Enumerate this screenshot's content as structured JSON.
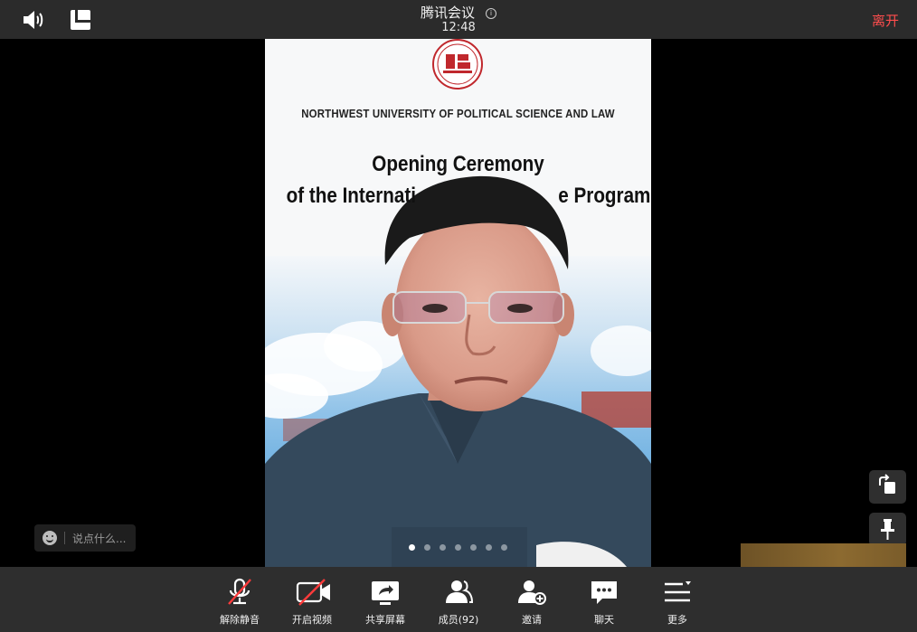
{
  "header": {
    "title": "腾讯会议",
    "time": "12:48",
    "leave_label": "离开"
  },
  "icons": {
    "speaker": "speaker-icon",
    "layout": "layout-icon",
    "info": "info-icon",
    "rotate": "rotate-icon",
    "pin": "pin-icon"
  },
  "video": {
    "slide_org": "NORTHWEST UNIVERSITY OF POLITICAL SCIENCE AND LAW",
    "slide_title_line1": "Opening Ceremony",
    "slide_title_line2": "of the Internati",
    "slide_title_line2_end": "e Program",
    "page_dots": 7,
    "active_dot": 1
  },
  "chat": {
    "placeholder": "说点什么..."
  },
  "toolbar": {
    "unmute": "解除静音",
    "start_video": "开启视频",
    "share_screen": "共享屏幕",
    "members": "成员(92)",
    "invite": "邀请",
    "chat": "聊天",
    "more": "更多"
  },
  "colors": {
    "leave": "#ff4d4d",
    "muted_slash": "#ff3b3b",
    "topbar": "#2b2b2b",
    "toolbar": "#2e2e2e"
  }
}
